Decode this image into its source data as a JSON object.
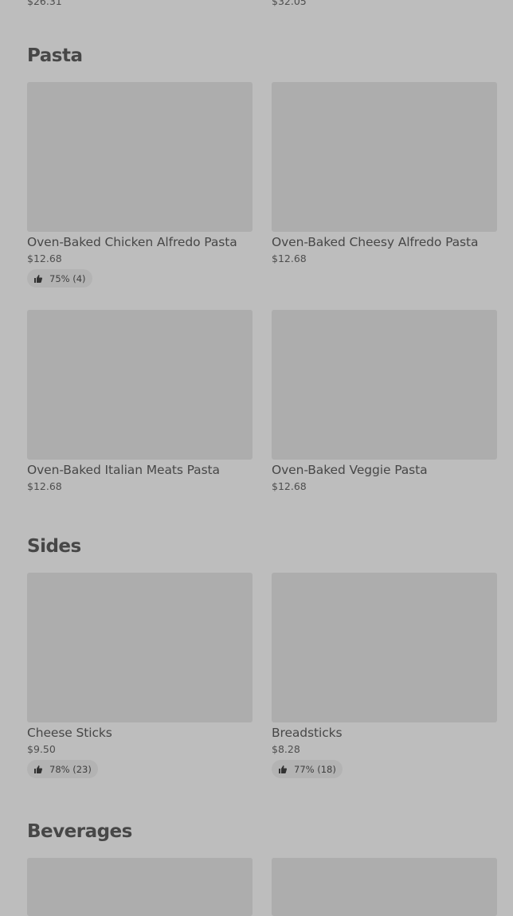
{
  "top_prices": [
    "$26.31",
    "$32.05"
  ],
  "sections": {
    "pasta": {
      "title": "Pasta",
      "items": [
        {
          "name": "Oven-Baked Chicken Alfredo Pasta",
          "price": "$12.68",
          "rating": "75% (4)"
        },
        {
          "name": "Oven-Baked Cheesy Alfredo Pasta",
          "price": "$12.68"
        },
        {
          "name": "Oven-Baked Italian Meats Pasta",
          "price": "$12.68"
        },
        {
          "name": "Oven-Baked Veggie Pasta",
          "price": "$12.68"
        }
      ]
    },
    "sides": {
      "title": "Sides",
      "items": [
        {
          "name": "Cheese Sticks",
          "price": "$9.50",
          "rating": "78% (23)"
        },
        {
          "name": "Breadsticks",
          "price": "$8.28",
          "rating": "77% (18)"
        }
      ]
    },
    "beverages": {
      "title": "Beverages"
    }
  },
  "icons": {
    "rating": "thumbs-up-icon"
  }
}
